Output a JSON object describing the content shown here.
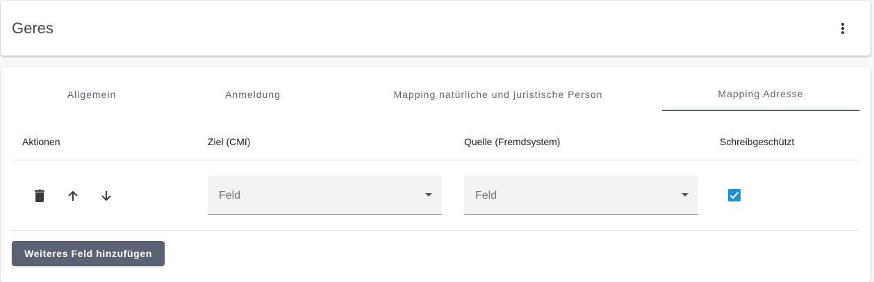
{
  "header": {
    "title": "Geres",
    "menu_icon": "more-vert-icon"
  },
  "tabs": [
    {
      "label": "Allgemein",
      "active": false
    },
    {
      "label": "Anmeldung",
      "active": false
    },
    {
      "label": "Mapping natürliche und juristische Person",
      "active": false
    },
    {
      "label": "Mapping Adresse",
      "active": true
    }
  ],
  "table": {
    "columns": [
      "Aktionen",
      "Ziel (CMI)",
      "Quelle (Fremdsystem)",
      "Schreibgeschützt"
    ],
    "rows": [
      {
        "actions": [
          "delete-icon",
          "arrow-up-icon",
          "arrow-down-icon"
        ],
        "ziel_placeholder": "Feld",
        "quelle_placeholder": "Feld",
        "schreibgeschuetzt": true
      }
    ]
  },
  "add_button_label": "Weiteres Feld hinzufügen",
  "colors": {
    "accent": "#56607a",
    "checkbox": "#1e90d8",
    "button": "#5a6273"
  }
}
